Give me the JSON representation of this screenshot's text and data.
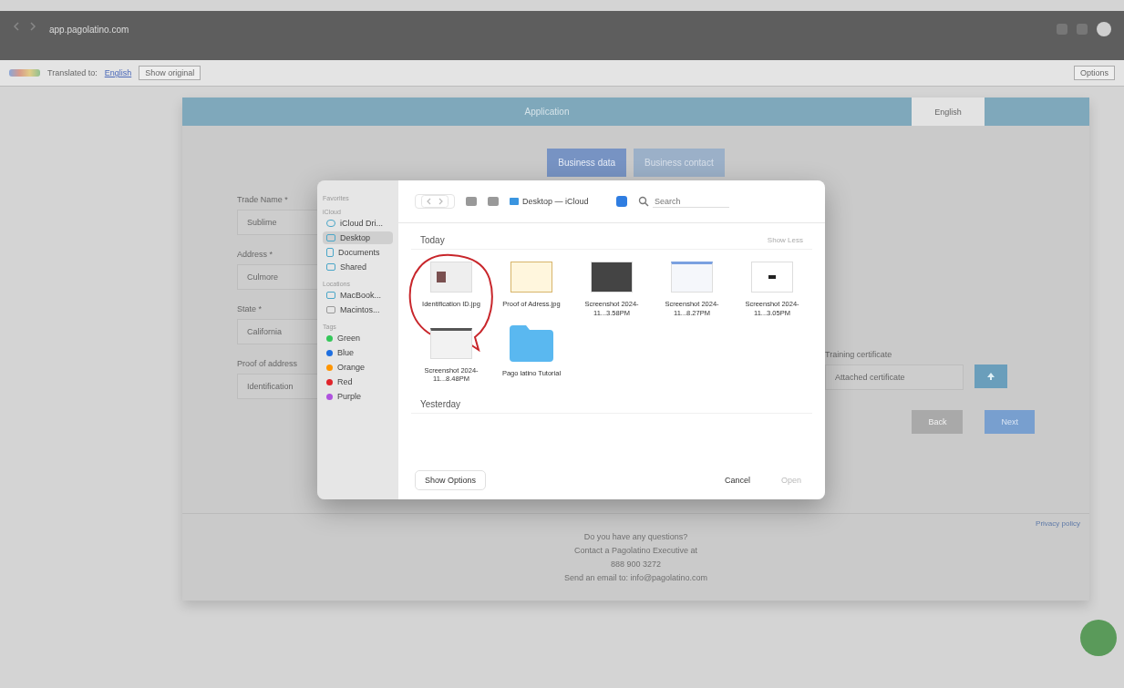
{
  "browser": {
    "url": "app.pagolatino.com"
  },
  "translate_bar": {
    "label": "Translated to:",
    "language": "English",
    "show_original": "Show original",
    "options": "Options"
  },
  "app_header": {
    "title": "Application",
    "language": "English"
  },
  "section_tabs": [
    {
      "label": "Business data",
      "selected": true
    },
    {
      "label": "Business contact",
      "selected": false
    }
  ],
  "form": {
    "fields": [
      {
        "label": "Trade Name *",
        "value": "Sublime"
      },
      {
        "label": "Address *",
        "value": "Culmore"
      },
      {
        "label": "State *",
        "value": "California"
      },
      {
        "label": "Proof of address",
        "value": "Identification"
      }
    ],
    "certificate": {
      "label": "Training certificate",
      "placeholder": "Attached certificate"
    },
    "buttons": [
      "Back",
      "Next"
    ]
  },
  "footer": {
    "lines": [
      "Do you have any questions?",
      "Contact a Pagolatino Executive at",
      "888 900 3272",
      "Send an email to: info@pagolatino.com"
    ],
    "link": "Privacy policy"
  },
  "dialog": {
    "sidebar": [
      {
        "heading": "Favorites"
      },
      {
        "heading": "iCloud",
        "items": [
          {
            "label": "iCloud Dri...",
            "kind": "cloud",
            "selected": false
          },
          {
            "label": "Desktop",
            "kind": "desktop",
            "selected": true
          },
          {
            "label": "Documents",
            "kind": "doc",
            "selected": false
          },
          {
            "label": "Shared",
            "kind": "shared",
            "selected": false
          }
        ]
      },
      {
        "heading": "Locations",
        "items": [
          {
            "label": "MacBook...",
            "kind": "laptop",
            "selected": false
          },
          {
            "label": "Macintos...",
            "kind": "disk",
            "selected": false
          }
        ]
      },
      {
        "heading": "Tags",
        "items": [
          {
            "label": "Green",
            "kind": "tag",
            "color": "#34c759",
            "selected": false
          },
          {
            "label": "Blue",
            "kind": "tag",
            "color": "#1e6fe0",
            "selected": false
          },
          {
            "label": "Orange",
            "kind": "tag",
            "color": "#ff9500",
            "selected": false
          },
          {
            "label": "Red",
            "kind": "tag",
            "color": "#e0242b",
            "selected": false
          },
          {
            "label": "Purple",
            "kind": "tag",
            "color": "#af52de",
            "selected": false
          }
        ]
      }
    ],
    "location": "Desktop — iCloud",
    "search_placeholder": "Search",
    "sections": [
      {
        "title": "Today",
        "action": "Show Less",
        "files": [
          {
            "name": "Identification ID.jpg",
            "kind": "id",
            "circled": true
          },
          {
            "name": "Proof of Adress.jpg",
            "kind": "doc",
            "circled": false
          },
          {
            "name": "Screenshot 2024-11...3.58PM",
            "kind": "dark",
            "circled": false
          },
          {
            "name": "Screenshot 2024-11...8.27PM",
            "kind": "web",
            "circled": false
          },
          {
            "name": "Screenshot 2024-11...3.05PM",
            "kind": "white",
            "circled": false
          },
          {
            "name": "Screenshot 2024-11...8.48PM",
            "kind": "table",
            "circled": false
          },
          {
            "name": "Pago latino Tutorial",
            "kind": "folder",
            "circled": false
          }
        ]
      },
      {
        "title": "Yesterday"
      }
    ],
    "show_options": "Show Options",
    "cancel": "Cancel",
    "open": "Open"
  }
}
